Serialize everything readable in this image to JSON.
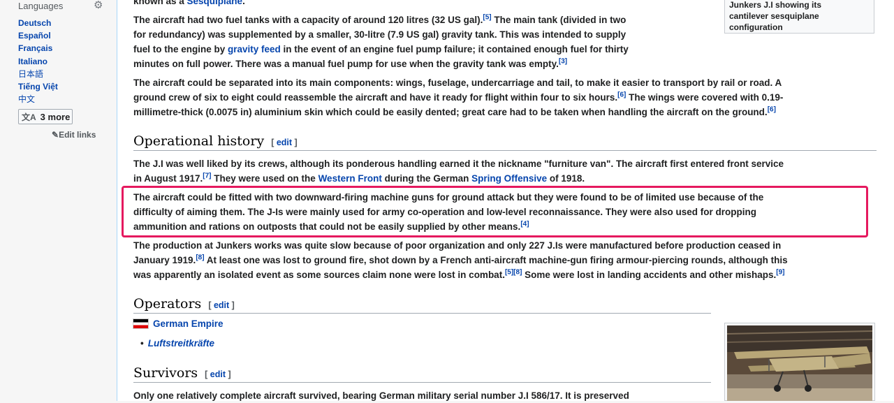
{
  "sidebar": {
    "languages_heading": "Languages",
    "languages": [
      "Deutsch",
      "Español",
      "Français",
      "Italiano",
      "日本語",
      "Tiếng Việt",
      "中文"
    ],
    "more_button_label": "3 more",
    "edit_links_label": "Edit links"
  },
  "thumb_top": {
    "caption_line1": "Junkers J.I showing its",
    "caption_line2": "cantilever sesquiplane",
    "caption_line3": "configuration"
  },
  "article": {
    "top_cut_text": "known as a ",
    "top_cut_link": "Sesquiplane",
    "p_fuel": {
      "t1": "The aircraft had two fuel tanks with a capacity of around 120 litres (32 US gal).",
      "ref1": "[5]",
      "t2": " The main tank (divided in two",
      "t3": "for redundancy) was supplemented by a smaller, 30-litre (7.9 US gal) gravity tank. This was intended to supply",
      "t4": "fuel to the engine by ",
      "link": "gravity feed",
      "t5": " in the event of an engine fuel pump failure; it contained enough fuel for thirty",
      "t6": "minutes on full power. There was a manual fuel pump for use when the gravity tank was empty.",
      "ref2": "[3]"
    },
    "p_components": {
      "t1": "The aircraft could be separated into its main components: wings, fuselage, undercarriage and tail, to make it easier to transport by rail or road. A",
      "t2": "ground crew of six to eight could reassemble the aircraft and have it ready for flight within four to six hours.",
      "ref1": "[6]",
      "t3": " The wings were covered with 0.19-",
      "t4": "millimetre-thick (0.0075 in) aluminium skin which could be easily dented; great care had to be taken when handling the aircraft on the ground.",
      "ref2": "[6]"
    },
    "h_operational": "Operational history",
    "edit_label": "edit",
    "p_op1": {
      "t1": "The J.I was well liked by its crews, although its ponderous handling earned it the nickname \"furniture van\". The aircraft first entered front service",
      "t2": "in August 1917.",
      "ref1": "[7]",
      "t3": " They were used on the ",
      "link1": "Western Front",
      "t4": " during the German ",
      "link2": "Spring Offensive",
      "t5": " of 1918."
    },
    "p_op2": {
      "t1": "The aircraft could be fitted with two downward-firing machine guns for ground attack but they were found to be of limited use because of the",
      "t2": "difficulty of aiming them. The J-Is were mainly used for army co-operation and low-level reconnaissance. They were also used for dropping",
      "t3": "ammunition and rations on outposts that could not be easily supplied by other means.",
      "ref1": "[4]"
    },
    "p_op3": {
      "t1": "The production at Junkers works was quite slow because of poor organization and only 227 J.Is were manufactured before production ceased in",
      "t2": "January 1919.",
      "ref1": "[8]",
      "t3": " At least one was lost to ground fire, shot down by a French anti-aircraft machine-gun firing armour-piercing rounds, although this",
      "t4": "was apparently an isolated event as some sources claim none were lost in combat.",
      "ref2": "[5][8]",
      "t5": " Some were lost in landing accidents and other mishaps.",
      "ref3": "[9]"
    },
    "h_operators": "Operators",
    "operator_country": "German Empire",
    "operator_unit": "Luftstreitkräfte",
    "h_survivors": "Survivors",
    "p_survivors": "Only one relatively complete aircraft survived, bearing German military serial number J.I 586/17. It is preserved"
  }
}
